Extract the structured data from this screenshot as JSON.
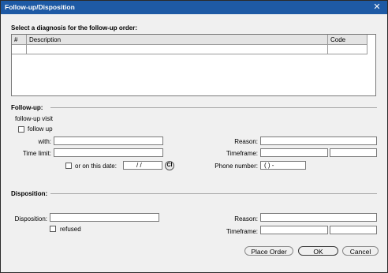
{
  "window": {
    "title": "Follow-up/Disposition",
    "close_glyph": "✕"
  },
  "diagnosis": {
    "label": "Select a diagnosis for the follow-up order:",
    "columns": [
      "#",
      "Description",
      "Code"
    ]
  },
  "followup": {
    "section_title": "Follow-up:",
    "visit_label": "follow-up visit",
    "checkbox_label": "follow up",
    "with_label": "with:",
    "time_limit_label": "Time limit:",
    "date_checkbox_label": "or on this date:",
    "date_value": "/ /",
    "calendar_glyph": "Cl",
    "reason_label": "Reason:",
    "timeframe_label": "Timeframe:",
    "phone_label": "Phone number:",
    "phone_value": "(  )   -"
  },
  "disposition": {
    "section_title": "Disposition:",
    "disposition_label": "Disposition:",
    "refused_label": "refused",
    "reason_label": "Reason:",
    "timeframe_label": "Timeframe:"
  },
  "buttons": {
    "place_order": "Place Order",
    "ok": "OK",
    "cancel": "Cancel"
  }
}
